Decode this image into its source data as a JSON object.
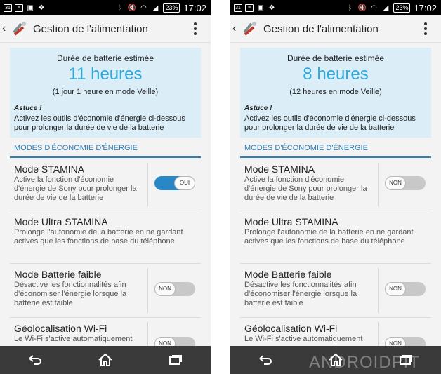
{
  "status_bar": {
    "calendar_day": "31",
    "battery": "23%",
    "time": "17:02"
  },
  "app": {
    "title": "Gestion de l'alimentation"
  },
  "screens": [
    {
      "estimate": {
        "label": "Durée de batterie estimée",
        "value": "11 heures",
        "sub": "(1 jour 1 heure en mode Veille)",
        "tip_heading": "Astuce !",
        "tip_text": "Activez les outils d'économie d'énergie ci-dessous pour prolonger la durée de vie de la batterie"
      },
      "section_header": "MODES D'ÉCONOMIE D'ÉNERGIE",
      "modes": [
        {
          "title": "Mode STAMINA",
          "desc": "Active la fonction d'économie d'énergie de Sony pour prolonger la durée de vie de la batterie",
          "toggle": "OUI",
          "on": true
        },
        {
          "title": "Mode Ultra STAMINA",
          "desc": "Prolonge l'autonomie de la batterie en ne gardant actives que les fonctions de base du téléphone"
        },
        {
          "title": "Mode Batterie faible",
          "desc": "Désactive les fonctionnalités afin d'économiser l'énergie lorsque la batterie est faible",
          "toggle": "NON",
          "on": false
        },
        {
          "title": "Géolocalisation Wi-Fi",
          "desc": "Le Wi-Fi s'active automatiquement",
          "toggle": "NON",
          "on": false
        }
      ]
    },
    {
      "estimate": {
        "label": "Durée de batterie estimée",
        "value": "8 heures",
        "sub": "(12 heures en mode Veille)",
        "tip_heading": "Astuce !",
        "tip_text": "Activez les outils d'économie d'énergie ci-dessous pour prolonger la durée de vie de la batterie"
      },
      "section_header": "MODES D'ÉCONOMIE D'ÉNERGIE",
      "modes": [
        {
          "title": "Mode STAMINA",
          "desc": "Active la fonction d'économie d'énergie de Sony pour prolonger la durée de vie de la batterie",
          "toggle": "NON",
          "on": false
        },
        {
          "title": "Mode Ultra STAMINA",
          "desc": "Prolonge l'autonomie de la batterie en ne gardant actives que les fonctions de base du téléphone"
        },
        {
          "title": "Mode Batterie faible",
          "desc": "Désactive les fonctionnalités afin d'économiser l'énergie lorsque la batterie est faible",
          "toggle": "NON",
          "on": false
        },
        {
          "title": "Géolocalisation Wi-Fi",
          "desc": "Le Wi-Fi s'active automatiquement",
          "toggle": "NON",
          "on": false
        }
      ]
    }
  ],
  "watermark": "ANDROIDPIT",
  "colors": {
    "accent": "#30a8d8",
    "section": "#2a7fb8",
    "toggle_on": "#2a87c6",
    "tip_bg": "#dbeef8"
  },
  "icons": [
    "calendar-icon",
    "image-icon",
    "dropbox-icon",
    "bluetooth-icon",
    "mute-icon",
    "wifi-icon",
    "signal-icon",
    "battery-icon",
    "back-nav-icon",
    "home-icon",
    "recent-apps-icon",
    "overflow-menu-icon"
  ]
}
